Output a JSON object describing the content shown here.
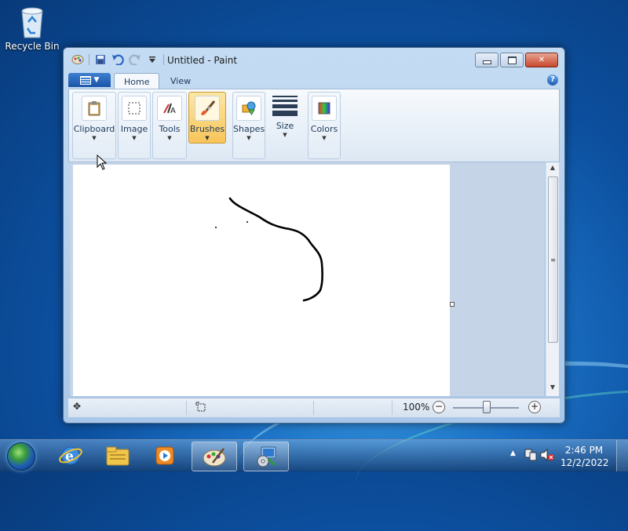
{
  "desktop": {
    "recycle_bin_label": "Recycle Bin"
  },
  "window": {
    "title": "Untitled - Paint",
    "buttons": {
      "minimize": "minimize-icon",
      "maximize": "maximize-icon",
      "close": "close-icon"
    }
  },
  "ribbon": {
    "tabs": [
      {
        "label": "Home",
        "active": true
      },
      {
        "label": "View",
        "active": false
      }
    ],
    "help": "?",
    "groups": [
      {
        "label": "Clipboard",
        "icon": "clipboard-icon"
      },
      {
        "label": "Image",
        "icon": "image-select-icon"
      },
      {
        "label": "Tools",
        "icon": "tools-icon"
      },
      {
        "label": "Brushes",
        "icon": "brush-icon",
        "active": true
      },
      {
        "label": "Shapes",
        "icon": "shapes-icon"
      },
      {
        "label": "Size",
        "icon": "size-icon"
      },
      {
        "label": "Colors",
        "icon": "colors-icon"
      }
    ]
  },
  "statusbar": {
    "zoom": "100%",
    "zoom_out": "−",
    "zoom_in": "+"
  },
  "taskbar": {
    "items": [
      "internet-explorer-icon",
      "file-explorer-icon",
      "media-player-icon",
      "paint-icon",
      "installer-icon"
    ],
    "clock_time": "2:46 PM",
    "clock_date": "12/2/2022"
  },
  "colors": {
    "accent": "#f8c55a",
    "window_frame": "#c4dcf3"
  }
}
